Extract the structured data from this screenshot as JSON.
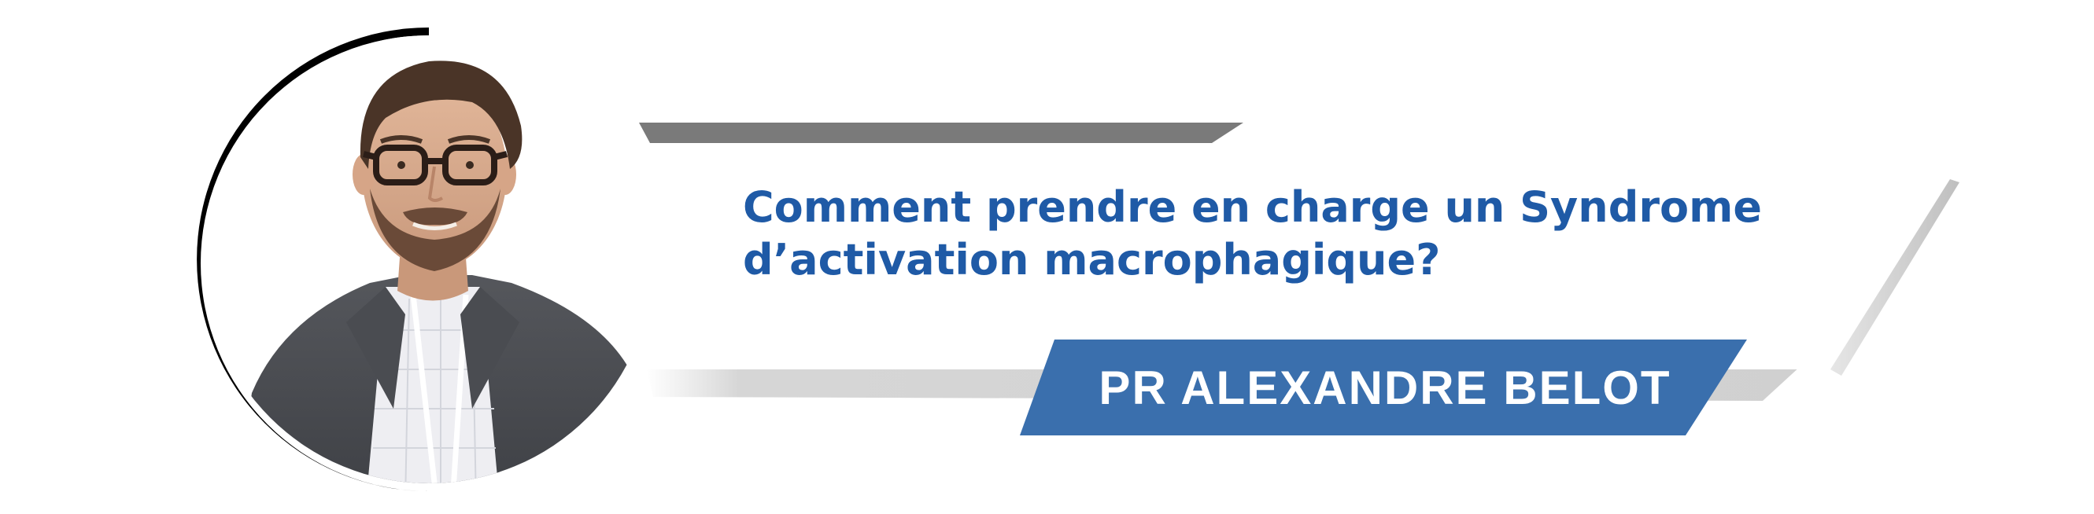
{
  "banner": {
    "title_lines": [
      "Comment prendre en charge un Syndrome",
      "d’activation macrophagique?"
    ],
    "speaker": "PR ALEXANDRE BELOT"
  },
  "colors": {
    "title_text": "#1f5aa6",
    "name_band": "#3a6fad",
    "top_bar": "#7a7a7a",
    "panel_shadow": "#cfcfcf",
    "ring": "#000000"
  },
  "portrait": {
    "icon": "speaker-portrait-photo"
  }
}
